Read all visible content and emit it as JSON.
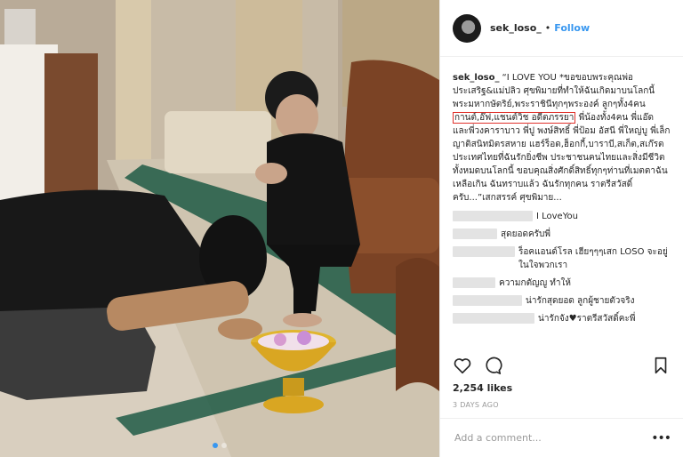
{
  "header": {
    "username": "sek_loso_",
    "separator": "•",
    "follow_label": "Follow"
  },
  "caption": {
    "username": "sek_loso_",
    "text_before": "“I LOVE YOU *ขอขอบพระคุณพ่อประเสริฐ&แม่ปลิว ศุขพิมายที่ทำให้ฉันเกิดมาบนโลกนี้ พระมหากษัตริย์,พระราชินีทุกๆพระองค์ ลูกๆทั้ง4คน ",
    "highlighted": "กานต์,อ๊ฟ,แชนต์วิช อดีตภรรยา",
    "text_after": " พี่น้องทั้ง4คน พี่แอ๊ด และพี่วงคาราบาว พี่ปู พงษ์สิทธิ์ พี่ป้อม อัสนี พี่ใหญ่บู พี่เล็ก ญาติสนิทมิตรสหาย แฮร์ร็อด,ฮ็อกกี้,บาราบี,สเก็ต,สเก๊รต ประเทศไทยที่ฉันรักยิ่งชีพ ประชาชนคนไทยและสิ่งมีชีวิตทั้งหมดบนโลกนี้ ขอบคุณสิ่งศักดิ์สิทธิ์ทุกๆท่านที่เมตตาฉันเหลือเกิน ฉันทราบแล้ว ฉันรักทุกคน ราตรีสวัสดิ์ครับ...”เสกสรรค์ ศุขพิมาย..."
  },
  "comments": [
    {
      "text": "I LoveYou"
    },
    {
      "text": "สุดยอดครับพี่"
    },
    {
      "text": "ร็อคแอนด์โรล เฮียๆๆๆเสก LOSO จะอยู่ในใจพวกเรา"
    },
    {
      "text": "ความกตัญญู ทำให้"
    },
    {
      "text": "น่ารักสุดยอด ลูกผู้ชายตัวจริง"
    },
    {
      "text": "น่ารักจัง♥ราตรีสวัสดิ์คะพี่"
    }
  ],
  "likes": "2,254 likes",
  "timestamp": "3 DAYS AGO",
  "add_comment": {
    "placeholder": "Add a comment..."
  },
  "more_label": "•••",
  "carousel": {
    "count": 2,
    "active_index": 0
  },
  "colors": {
    "accent": "#3897f0",
    "highlight_box": "#e0312b",
    "muted_text": "#999999"
  },
  "icons": [
    "heart-icon",
    "comment-icon",
    "bookmark-icon",
    "more-options-icon"
  ]
}
